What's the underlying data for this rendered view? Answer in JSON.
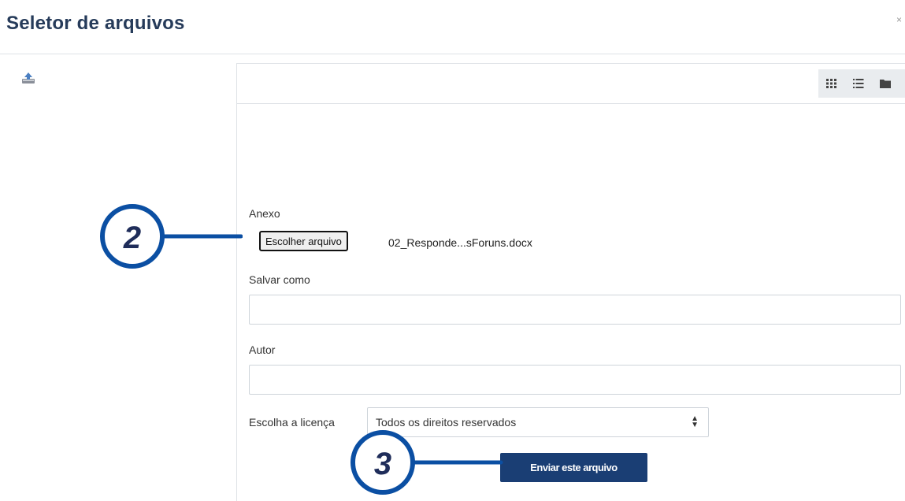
{
  "dialog": {
    "title": "Seletor de arquivos",
    "close_glyph": "×"
  },
  "sidebar": {
    "repository_icon": "upload-repository-icon"
  },
  "toolbar": {
    "view_buttons": [
      "grid-view-icon",
      "list-view-icon",
      "folder-view-icon"
    ]
  },
  "form": {
    "attachment_label": "Anexo",
    "choose_file_label": "Escolher arquivo",
    "selected_file": "02_Responde...sForuns.docx",
    "save_as_label": "Salvar como",
    "save_as_value": "",
    "author_label": "Autor",
    "author_value": "",
    "license_label": "Escolha a licença",
    "license_value": "Todos os direitos reservados",
    "upload_button": "Enviar este arquivo"
  },
  "annotations": {
    "step_2": "2",
    "step_3": "3",
    "callout_color": "#0b4fa3"
  },
  "colors": {
    "title": "#263b5a",
    "primary_button": "#1a3e74"
  }
}
